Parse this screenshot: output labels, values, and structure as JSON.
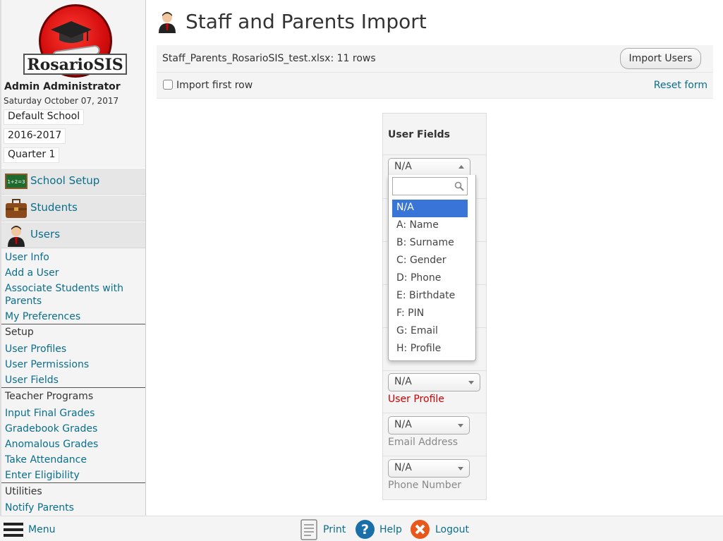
{
  "sidebar": {
    "logo_text": "RosarioSIS",
    "user_name": "Admin Administrator",
    "date": "Saturday October 07, 2017",
    "school": "Default School",
    "school_year": "2016-2017",
    "quarter": "Quarter 1",
    "sections": [
      {
        "label": "School Setup",
        "icon": "chalkboard-icon"
      },
      {
        "label": "Students",
        "icon": "briefcase-icon"
      },
      {
        "label": "Users",
        "icon": "user-icon"
      }
    ],
    "users_links": [
      "User Info",
      "Add a User",
      "Associate Students with Parents",
      "My Preferences"
    ],
    "setup_heading": "Setup",
    "setup_links": [
      "User Profiles",
      "User Permissions",
      "User Fields"
    ],
    "teacher_heading": "Teacher Programs",
    "teacher_links": [
      "Input Final Grades",
      "Gradebook Grades",
      "Anomalous Grades",
      "Take Attendance",
      "Enter Eligibility"
    ],
    "utilities_heading": "Utilities",
    "utilities_links": [
      "Notify Parents"
    ]
  },
  "main": {
    "title": "Staff and Parents Import",
    "file_info": "Staff_Parents_RosarioSIS_test.xlsx: 11 rows",
    "import_button": "Import Users",
    "import_first_row": "Import first row",
    "reset_form": "Reset form",
    "fields_heading": "User Fields",
    "first_select_value": "N/A",
    "rows": [
      {
        "value": "N/A",
        "label": "User Profile",
        "required": true
      },
      {
        "value": "N/A",
        "label": "Email Address",
        "required": false
      },
      {
        "value": "N/A",
        "label": "Phone Number",
        "required": false
      }
    ],
    "dropdown_options": [
      "N/A",
      "A: Name",
      "B: Surname",
      "C: Gender",
      "D: Phone",
      "E: Birthdate",
      "F: PIN",
      "G: Email",
      "H: Profile"
    ]
  },
  "footer": {
    "menu": "Menu",
    "print": "Print",
    "help": "Help",
    "logout": "Logout"
  },
  "colors": {
    "link": "#0a6e8c",
    "required": "#cc0000",
    "highlight": "#3875d7",
    "logo_red": "#d60f0f"
  }
}
